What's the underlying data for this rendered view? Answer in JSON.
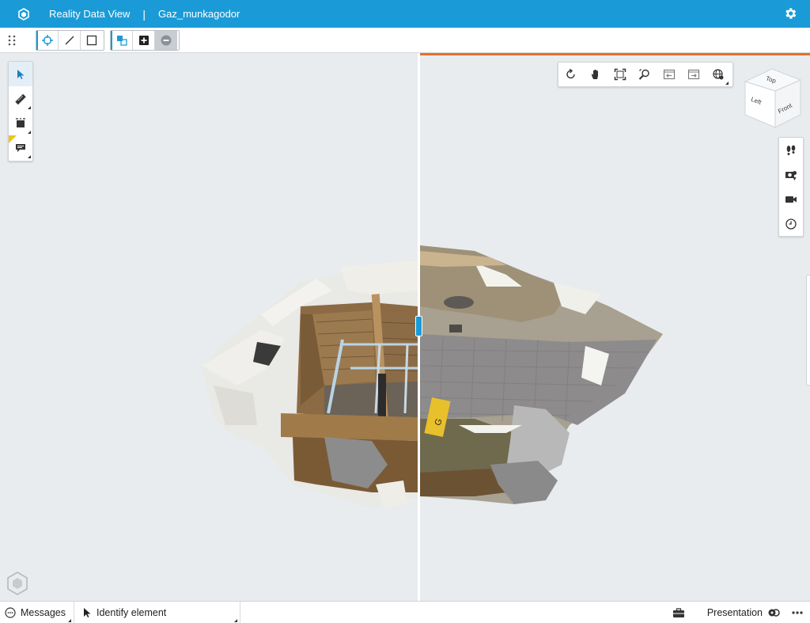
{
  "titlebar": {
    "app_name": "Reality Data View",
    "separator": "|",
    "project_name": "Gaz_munkagodor",
    "app_icon": "bentley-app-icon",
    "settings_icon": "gear-icon"
  },
  "toolbar": {
    "groups": [
      {
        "name": "selection-tools",
        "items": [
          "target-select-icon",
          "line-select-icon",
          "box-select-icon"
        ]
      },
      {
        "name": "selection-mode",
        "items": [
          "selection-set-icon",
          "add-selection-icon",
          "remove-selection-icon"
        ]
      }
    ]
  },
  "left_tools": [
    "select-cursor-icon",
    "measure-tool-icon",
    "clip-box-icon",
    "markup-comment-icon"
  ],
  "nav_tools": [
    "rotate-view-icon",
    "pan-hand-icon",
    "fit-view-icon",
    "zoom-window-icon",
    "previous-view-icon",
    "next-view-icon",
    "globe-view-icon"
  ],
  "view_cube": {
    "top": "Top",
    "left": "Left",
    "front": "Front"
  },
  "right_tools": [
    "walk-icon",
    "camera-location-icon",
    "video-camera-icon",
    "clock-history-icon"
  ],
  "statusbar": {
    "messages_label": "Messages",
    "identify_label": "Identify element",
    "presentation_label": "Presentation"
  },
  "colors": {
    "header_blue": "#1a9bd7",
    "viewport_bg": "#e8ecef",
    "split_accent": "#e5702a"
  }
}
